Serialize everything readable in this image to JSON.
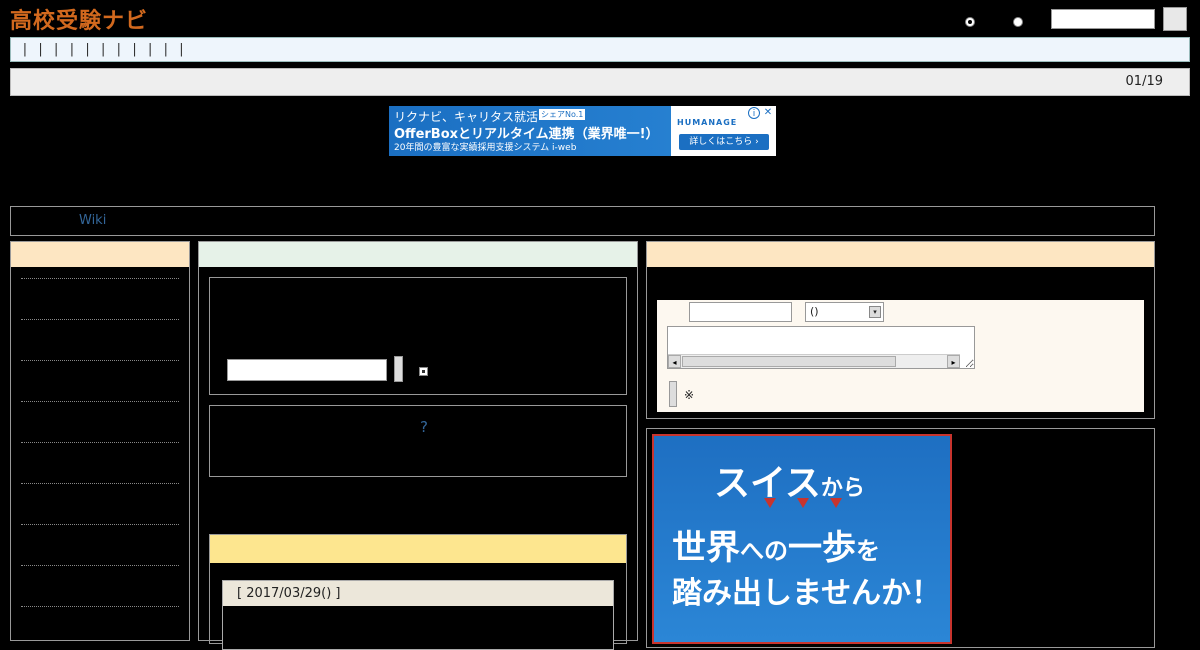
{
  "header": {
    "logo_text": "高校受験ナビ",
    "search_input_value": "",
    "search_button_label": ""
  },
  "nav": {
    "items_text": "| | | | | | | | | | |"
  },
  "date_bar": {
    "date": "01/19"
  },
  "ad": {
    "line1": "リクナビ、キャリタス就活",
    "tag": "シェアNo.1",
    "line2": "OfferBoxとリアルタイム連携（業界唯一!）",
    "line3": "20年間の豊富な実績採用支援システム i-web",
    "brand": "HUMANAGE",
    "cta": "詳しくはこちら ›",
    "close_glyph": "✕",
    "info_glyph": "i"
  },
  "wiki_bar": {
    "link_text": "Wiki"
  },
  "middle": {
    "help_link": "?",
    "news_item_header": "[ 2017/03/29() ]"
  },
  "right": {
    "select_value": "()",
    "select_arrow": "▾",
    "scroll_left": "◂",
    "scroll_right": "▸",
    "note": "※"
  },
  "promo": {
    "line1_main": "スイス",
    "line1_small": "から",
    "line2_a": "世界",
    "line2_b": "への",
    "line2_c": "一歩",
    "line2_d": "を",
    "line3": "踏み出しませんか！"
  },
  "colors": {
    "logo": "#d2691e",
    "link": "#336699",
    "promo_bg": "#1e6fc2",
    "promo_border": "#c8342e"
  }
}
